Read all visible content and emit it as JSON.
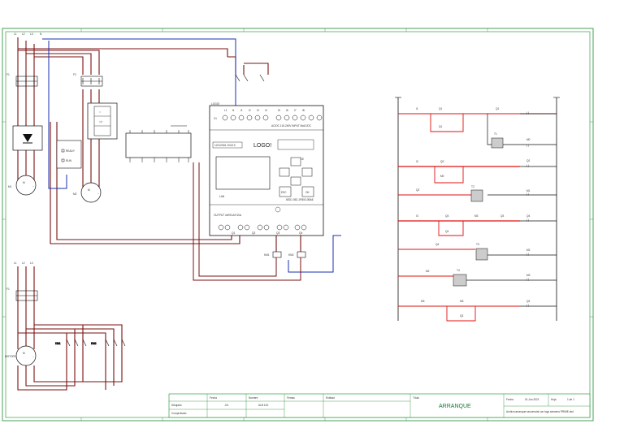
{
  "logo": {
    "brand": "LOGO!",
    "input_header": "AC/DC 115-240V INPUT 8xAC/DC",
    "output_header": "OUTPUT 4xRELAY/10A",
    "model": "230RCE",
    "order_no": "6ED1 052-1FB00-0BA6",
    "display_text": "12/1/2016 10:02:0",
    "lan": "LAN",
    "esc_key": "ESC",
    "ok_key": "OK",
    "input_terminals": [
      "L1",
      "N",
      "I1",
      "I2",
      "I3",
      "I4",
      "I5",
      "I6",
      "I7",
      "I8"
    ],
    "output_groups": [
      "Q1",
      "Q2",
      "Q3",
      "Q4"
    ],
    "x1_label": "X1"
  },
  "power": {
    "supply_labels": [
      "L1",
      "L2",
      "L3",
      "N"
    ],
    "breaker_labels": [
      "F1",
      "F2"
    ],
    "motor_labels": [
      "M1",
      "M2"
    ],
    "motor_name": "MOTOR1",
    "ready_label": "READY",
    "run_label": "RUN",
    "contactor_labels": [
      "KM1",
      "KM2"
    ],
    "q_labels": [
      "Q1",
      "Q2",
      "Q3",
      "Q4"
    ]
  },
  "ladder": {
    "rung_contacts": [
      "I1",
      "Q1",
      "I2",
      "Q2",
      "I3",
      "I4",
      "Q4",
      "M3",
      "Q3",
      "M0"
    ],
    "coils": [
      "Q1",
      "M0",
      "Q2",
      "M1",
      "Q4",
      "M2",
      "M3",
      "Q3"
    ],
    "timers": [
      "T1",
      "T2",
      "T3",
      "T4"
    ]
  },
  "title_block": {
    "headers": [
      "Fecha",
      "Nombre",
      "Firmas",
      "Entidad"
    ],
    "rows": [
      {
        "label": "Dibujado",
        "fecha": "-00-",
        "nombre": "ALB 100"
      },
      {
        "label": "Comprobado",
        "fecha": "",
        "nombre": ""
      }
    ],
    "title_label": "Título",
    "title": "ARRANQUE",
    "date_label": "Fecha",
    "date": "01.Jun.2021",
    "sheet_label": "Hoja",
    "sheet": "1 de 1",
    "file": "Archivo:arranque secuencial con logo siemens PRIME.dwt"
  },
  "colors": {
    "border": "#1a8a2a",
    "power_wire": "#7a1010",
    "neutral_wire": "#1a2fb0",
    "control_wire": "#e01010",
    "line": "#111111"
  }
}
